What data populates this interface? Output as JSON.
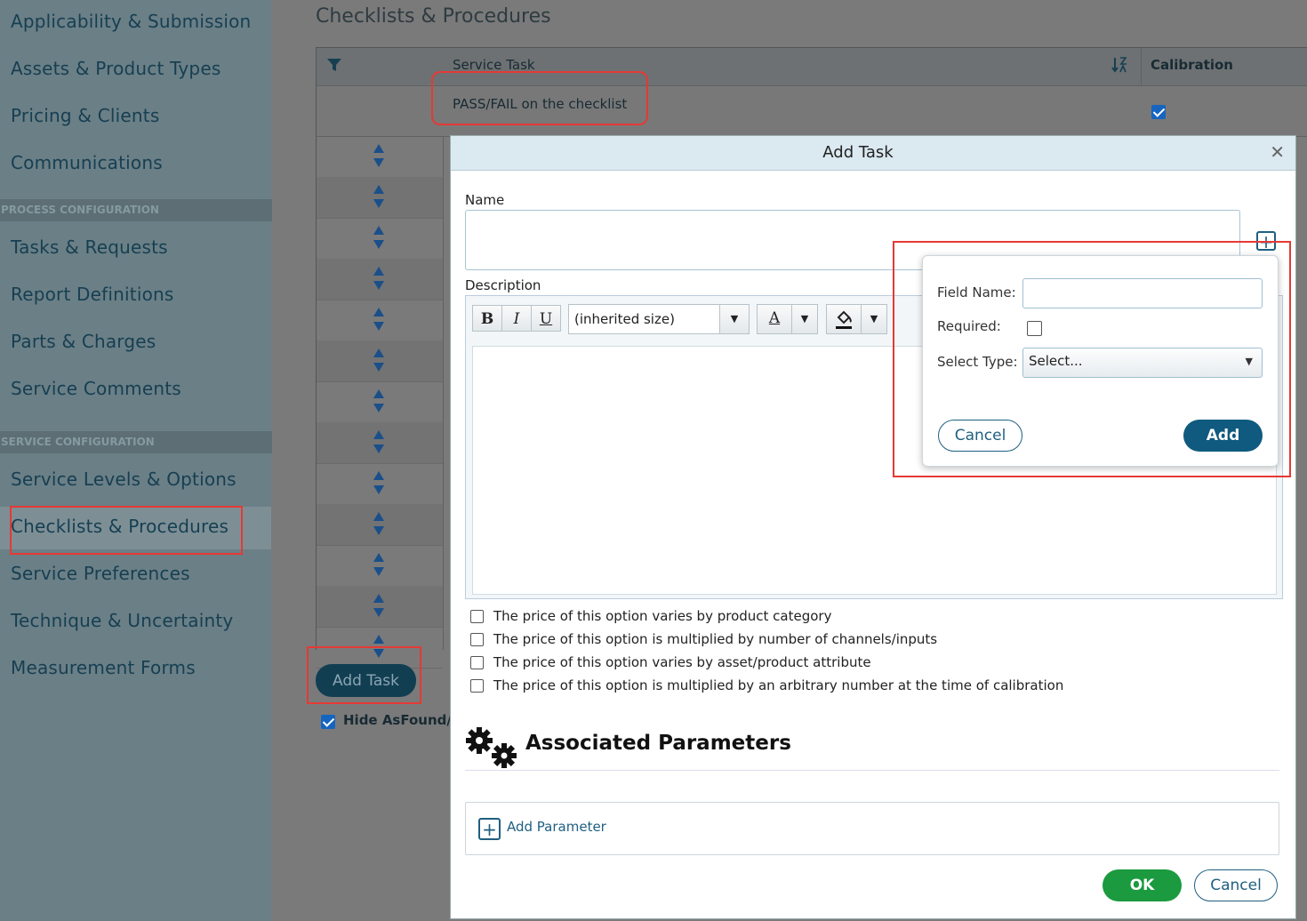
{
  "sidebar": {
    "items_top": [
      "Applicability & Submission",
      "Assets & Product Types",
      "Pricing & Clients",
      "Communications"
    ],
    "section_process": "PROCESS CONFIGURATION",
    "items_process": [
      "Tasks & Requests",
      "Report Definitions",
      "Parts & Charges",
      "Service Comments"
    ],
    "section_service": "SERVICE CONFIGURATION",
    "items_service": [
      "Service Levels & Options",
      "Checklists & Procedures",
      "Service Preferences",
      "Technique & Uncertainty",
      "Measurement Forms"
    ]
  },
  "main": {
    "title": "Checklists & Procedures",
    "grid": {
      "col_service_task": "Service Task",
      "col_calibration": "Calibration",
      "row0_task": "PASS/FAIL on the checklist",
      "row0_calibration_checked": true
    },
    "add_task_button": "Add Task",
    "hide_checkbox_label": "Hide AsFound/A",
    "hide_checkbox_checked": true
  },
  "modal": {
    "title": "Add Task",
    "close_icon": "close-icon",
    "name_label": "Name",
    "name_value": "",
    "description_label": "Description",
    "toolbar": {
      "bold": "B",
      "italic": "I",
      "underline": "U",
      "font_size": "(inherited size)",
      "font_color_glyph": "A"
    },
    "options": [
      "The price of this option varies by product category",
      "The price of this option is multiplied by number of channels/inputs",
      "The price of this option varies by asset/product attribute",
      "The price of this option is multiplied by an arbitrary number at the time of calibration"
    ],
    "associated_parameters_title": "Associated Parameters",
    "add_parameter_label": "Add Parameter",
    "ok_button": "OK",
    "cancel_button": "Cancel"
  },
  "popover": {
    "field_name_label": "Field Name:",
    "field_name_value": "",
    "required_label": "Required:",
    "required_checked": false,
    "select_type_label": "Select Type:",
    "select_type_value": "Select...",
    "cancel_button": "Cancel",
    "add_button": "Add"
  },
  "colors": {
    "sidebar_bg": "#6b7f86",
    "nav_text": "#163f52",
    "ok_green": "#1b9a3f",
    "primary_blue": "#0f5a7e",
    "highlight_red": "#e53935"
  }
}
